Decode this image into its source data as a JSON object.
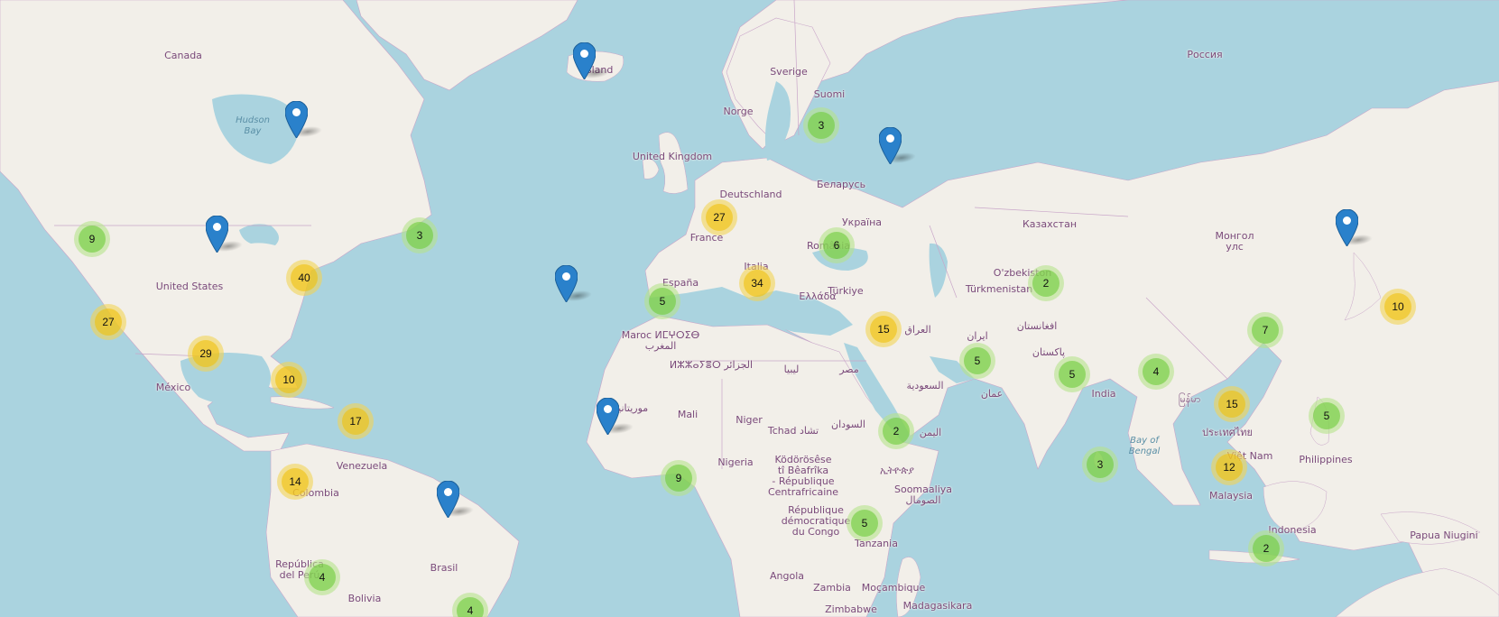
{
  "map": {
    "colors": {
      "water": "#aad3df",
      "land": "#f2efe9",
      "border": "#c9a6c9",
      "cluster_small": "#6ecc39",
      "cluster_medium": "#f0c20c",
      "marker": "#2a81cb"
    },
    "labels": {
      "canada": "Canada",
      "hudson_bay": "Hudson\nBay",
      "united_states": "United States",
      "mexico": "México",
      "venezuela": "Venezuela",
      "colombia": "Colombia",
      "brasil": "Brasil",
      "republica_del_peru": "República\ndel Perú",
      "bolivia": "Bolivia",
      "iceland": "Ísland",
      "sverige": "Sverige",
      "suomi": "Suomi",
      "norge": "Norge",
      "united_kingdom": "United Kingdom",
      "deutschland": "Deutschland",
      "france": "France",
      "espana": "España",
      "italia": "Italia",
      "romania": "România",
      "belarus": "Беларусь",
      "ukraina": "Україна",
      "rossiya": "Россия",
      "kazakhstan": "Казахстан",
      "mongolia": "Монгол\nулс",
      "turkiye": "Türkiye",
      "ellada": "Ελλάδα",
      "uzbekistan": "O'zbekiston",
      "turkmenistan": "Türkmenistan",
      "iran": "ایران",
      "afghanistan": "افغانستان",
      "pakistan": "پاکستان",
      "iraq": "العراق",
      "saudi": "السعودية",
      "oman": "عمان",
      "yemen": "اليمن",
      "india": "India",
      "bay_of_bengal": "Bay of\nBengal",
      "myanmar": "မြန်မာ",
      "thailand": "ประเทศไทย",
      "vietnam": "Việt Nam",
      "philippines": "Philippines",
      "malaysia": "Malaysia",
      "indonesia": "Indonesia",
      "papua": "Papua Niugini",
      "morocco": "Maroc ⵍⵎⵖⵔⵉⴱ\nالمغرب",
      "algeria": "ⵍⵣⵣⴰⵢⴻⵔ الجزائر",
      "libya": "ليبيا",
      "egypt": "مصر",
      "mauritania": "موريتانيا",
      "mali": "Mali",
      "niger": "Niger",
      "tchad": "Tchad تشاد",
      "sudan": "السودان",
      "nigeria": "Nigeria",
      "car": "Ködörösêse\ntî Bêafrîka\n- République\nCentrafricaine",
      "ethiopia": "ኢትዮጵያ",
      "somalia": "Soomaaliya\nالصومال",
      "drc": "République\ndémocratique\ndu Congo",
      "tanzania": "Tanzania",
      "angola": "Angola",
      "zambia": "Zambia",
      "mocambique": "Moçambique",
      "zimbabwe": "Zimbabwe",
      "madagasikara": "Madagasikara"
    },
    "clusters": [
      {
        "count": "9",
        "size": "small"
      },
      {
        "count": "3",
        "size": "small"
      },
      {
        "count": "40",
        "size": "medium"
      },
      {
        "count": "27",
        "size": "medium"
      },
      {
        "count": "29",
        "size": "medium"
      },
      {
        "count": "10",
        "size": "medium"
      },
      {
        "count": "17",
        "size": "medium"
      },
      {
        "count": "14",
        "size": "medium"
      },
      {
        "count": "4",
        "size": "small"
      },
      {
        "count": "4",
        "size": "small"
      },
      {
        "count": "3",
        "size": "small"
      },
      {
        "count": "27",
        "size": "medium"
      },
      {
        "count": "6",
        "size": "small"
      },
      {
        "count": "34",
        "size": "medium"
      },
      {
        "count": "5",
        "size": "small"
      },
      {
        "count": "15",
        "size": "medium"
      },
      {
        "count": "2",
        "size": "small"
      },
      {
        "count": "5",
        "size": "small"
      },
      {
        "count": "5",
        "size": "small"
      },
      {
        "count": "2",
        "size": "small"
      },
      {
        "count": "9",
        "size": "small"
      },
      {
        "count": "5",
        "size": "small"
      },
      {
        "count": "4",
        "size": "small"
      },
      {
        "count": "3",
        "size": "small"
      },
      {
        "count": "15",
        "size": "medium"
      },
      {
        "count": "12",
        "size": "medium"
      },
      {
        "count": "7",
        "size": "small"
      },
      {
        "count": "10",
        "size": "medium"
      },
      {
        "count": "5",
        "size": "small"
      },
      {
        "count": "2",
        "size": "small"
      }
    ],
    "markers": [
      {
        "name": "hudson-bay-marker"
      },
      {
        "name": "minnesota-marker"
      },
      {
        "name": "iceland-marker"
      },
      {
        "name": "russia-marker"
      },
      {
        "name": "azores-marker"
      },
      {
        "name": "senegal-marker"
      },
      {
        "name": "brazil-marker"
      },
      {
        "name": "manchuria-marker"
      }
    ]
  }
}
